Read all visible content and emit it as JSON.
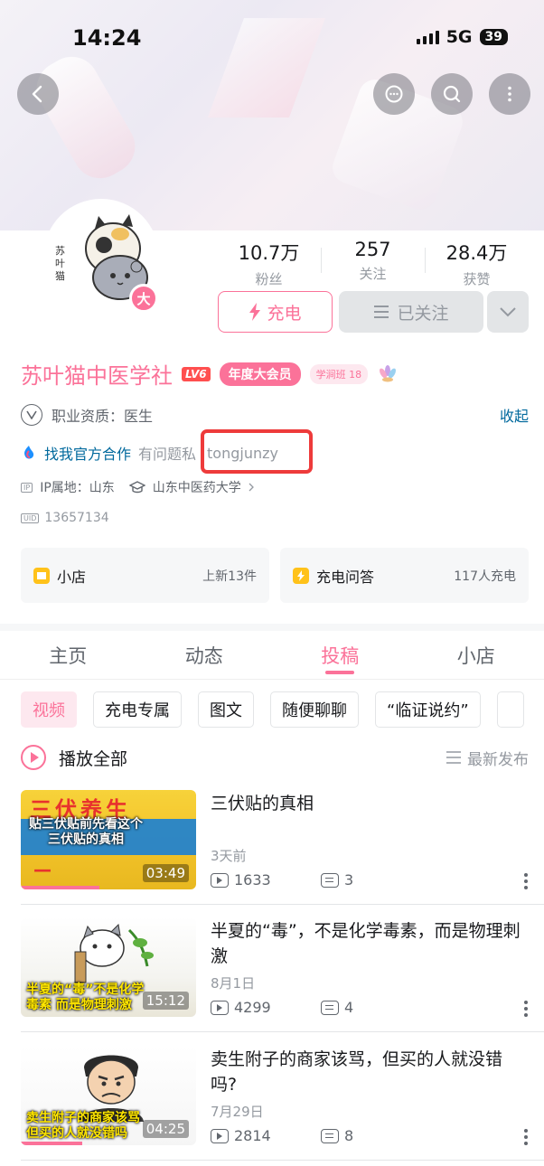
{
  "status_bar": {
    "time": "14:24",
    "network": "5G",
    "battery": "39"
  },
  "profile": {
    "name": "苏叶猫中医学社",
    "level": "LV6",
    "vip_badge": "年度大会员",
    "class_badge": "学涧班 18",
    "avatar_badge": "大",
    "avatar_text": "苏叶猫",
    "qualification": "职业资质：医生",
    "collapse_label": "收起",
    "contact_link": "找我官方合作",
    "contact_hint": "有问题私",
    "contact_handle": "tongjunzy",
    "ip_tag": "IP",
    "ip_location": "IP属地：山东",
    "school": "山东中医药大学",
    "uid_tag": "UID",
    "uid": "13657134",
    "accent_color": "#fb7299"
  },
  "stats": [
    {
      "value": "10.7万",
      "label": "粉丝"
    },
    {
      "value": "257",
      "label": "关注"
    },
    {
      "value": "28.4万",
      "label": "获赞"
    }
  ],
  "actions": {
    "charge_label": "充电",
    "followed_label": "已关注"
  },
  "cards": [
    {
      "title": "小店",
      "meta": "上新13件",
      "icon": "shop-icon"
    },
    {
      "title": "充电问答",
      "meta": "117人充电",
      "icon": "charge-qa-icon"
    }
  ],
  "tabs": [
    {
      "label": "主页",
      "active": false
    },
    {
      "label": "动态",
      "active": false
    },
    {
      "label": "投稿",
      "active": true
    },
    {
      "label": "小店",
      "active": false
    }
  ],
  "chips": [
    {
      "label": "视频",
      "active": true
    },
    {
      "label": "充电专属",
      "active": false
    },
    {
      "label": "图文",
      "active": false
    },
    {
      "label": "随便聊聊",
      "active": false
    },
    {
      "label": "“临证说约”",
      "active": false
    }
  ],
  "play_all": {
    "label": "播放全部",
    "sort_label": "最新发布"
  },
  "videos": [
    {
      "title": "三伏贴的真相",
      "date": "3天前",
      "plays": "1633",
      "danmaku": "3",
      "duration": "03:49",
      "thumb_caption": "贴三伏贴前先看这个 三伏贴的真相",
      "thumb_text": "三伏养生",
      "progress": 0.45
    },
    {
      "title": "半夏的“毒”，不是化学毒素，而是物理刺激",
      "date": "8月1日",
      "plays": "4299",
      "danmaku": "4",
      "duration": "15:12",
      "thumb_caption": "半夏的“毒”不是化学毒素 而是物理刺激",
      "thumb_text": "",
      "progress": 0
    },
    {
      "title": "卖生附子的商家该骂，但买的人就没错吗?",
      "date": "7月29日",
      "plays": "2814",
      "danmaku": "8",
      "duration": "04:25",
      "thumb_caption": "卖生附子的商家该骂 但买的人就没错吗",
      "thumb_text": "",
      "progress": 0.35
    }
  ]
}
